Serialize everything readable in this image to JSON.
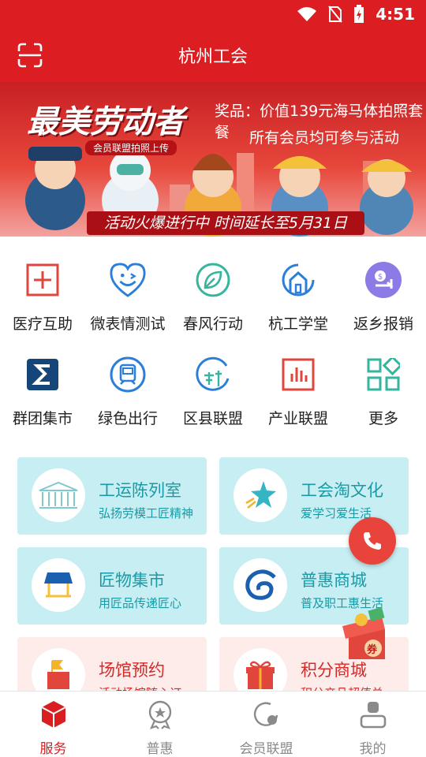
{
  "status_bar": {
    "time": "4:51"
  },
  "app_bar": {
    "title": "杭州工会"
  },
  "banner": {
    "headline": "最美劳动者",
    "tag": "会员联盟拍照上传",
    "prize_line1": "奖品：价值139元海马体拍照套餐",
    "prize_line2": "所有会员均可参与活动",
    "ribbon": "活动火爆进行中 时间延长至5月31日"
  },
  "grid_row1": [
    {
      "label": "医疗互助",
      "icon": "medical-cross-icon"
    },
    {
      "label": "微表情测试",
      "icon": "smile-heart-icon"
    },
    {
      "label": "春风行动",
      "icon": "leaf-icon"
    },
    {
      "label": "杭工学堂",
      "icon": "house-icon"
    },
    {
      "label": "返乡报销",
      "icon": "money-return-icon"
    }
  ],
  "grid_row2": [
    {
      "label": "群团集市",
      "icon": "market-s-icon"
    },
    {
      "label": "绿色出行",
      "icon": "bus-icon"
    },
    {
      "label": "区县联盟",
      "icon": "globe-alliance-icon"
    },
    {
      "label": "产业联盟",
      "icon": "bar-chart-icon"
    },
    {
      "label": "更多",
      "icon": "grid-more-icon"
    }
  ],
  "cards": [
    {
      "title": "工运陈列室",
      "subtitle": "弘扬劳模工匠精神",
      "theme": "#c7eef2"
    },
    {
      "title": "工会淘文化",
      "subtitle": "爱学习爱生活",
      "theme": "#c7eef2"
    },
    {
      "title": "匠物集市",
      "subtitle": "用匠品传递匠心",
      "theme": "#c7eef2"
    },
    {
      "title": "普惠商城",
      "subtitle": "普及职工惠生活",
      "theme": "#c7eef2"
    },
    {
      "title": "场馆预约",
      "subtitle": "活动场馆随心订",
      "theme": "#fdecea"
    },
    {
      "title": "积分商城",
      "subtitle": "积分产品超值兑",
      "theme": "#fdecea"
    }
  ],
  "gift_badge": "券",
  "tab_bar": [
    {
      "label": "服务",
      "active": true
    },
    {
      "label": "普惠",
      "active": false
    },
    {
      "label": "会员联盟",
      "active": false
    },
    {
      "label": "我的",
      "active": false
    }
  ],
  "colors": {
    "brand_red": "#dc1e22",
    "teal": "#1a9aa6",
    "card_cyan": "#c7eef2",
    "card_pink": "#fdecea"
  }
}
